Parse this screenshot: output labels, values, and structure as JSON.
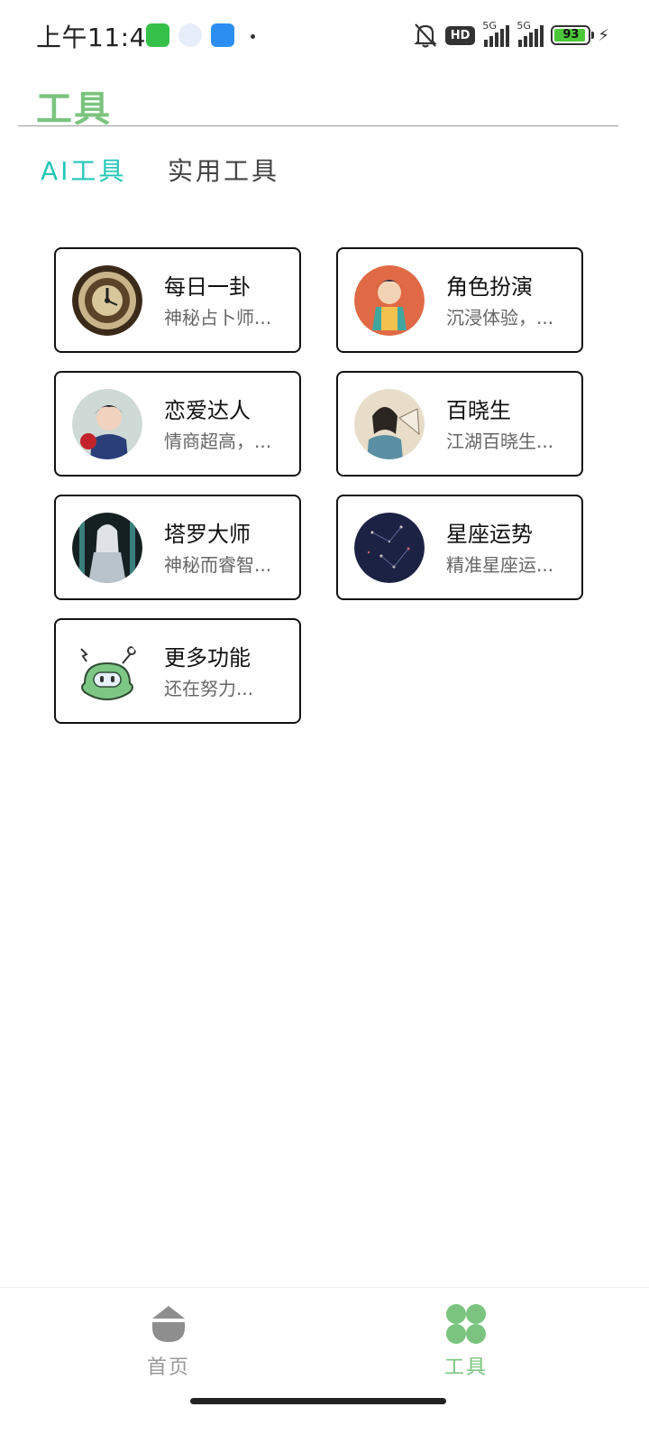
{
  "status_bar": {
    "time": "上午11:48",
    "hd_badge": "HD",
    "signal_1": "5G",
    "signal_2": "5G",
    "battery": "93",
    "battery_level": 0.93
  },
  "header": {
    "title": "工具"
  },
  "tabs": [
    {
      "label": "AI工具",
      "active": true
    },
    {
      "label": "实用工具",
      "active": false
    }
  ],
  "tools": [
    {
      "title": "每日一卦",
      "desc": "神秘占卜师...",
      "icon": "clock-avatar"
    },
    {
      "title": "角色扮演",
      "desc": "沉浸体验，...",
      "icon": "character-avatar"
    },
    {
      "title": "恋爱达人",
      "desc": "情商超高，...",
      "icon": "romance-avatar"
    },
    {
      "title": "百晓生",
      "desc": "江湖百晓生...",
      "icon": "scholar-avatar"
    },
    {
      "title": "塔罗大师",
      "desc": "神秘而睿智...",
      "icon": "tarot-avatar"
    },
    {
      "title": "星座运势",
      "desc": "精准星座运...",
      "icon": "constellation-avatar"
    },
    {
      "title": "更多功能",
      "desc": "还在努力...",
      "icon": "robot-icon"
    }
  ],
  "bottom_nav": {
    "home_label": "首页",
    "tools_label": "工具",
    "active": "tools",
    "accent": "#7bc47f",
    "inactive": "#999999"
  },
  "colors": {
    "title_green": "#7bc47f",
    "tab_active": "#22c6b8"
  }
}
